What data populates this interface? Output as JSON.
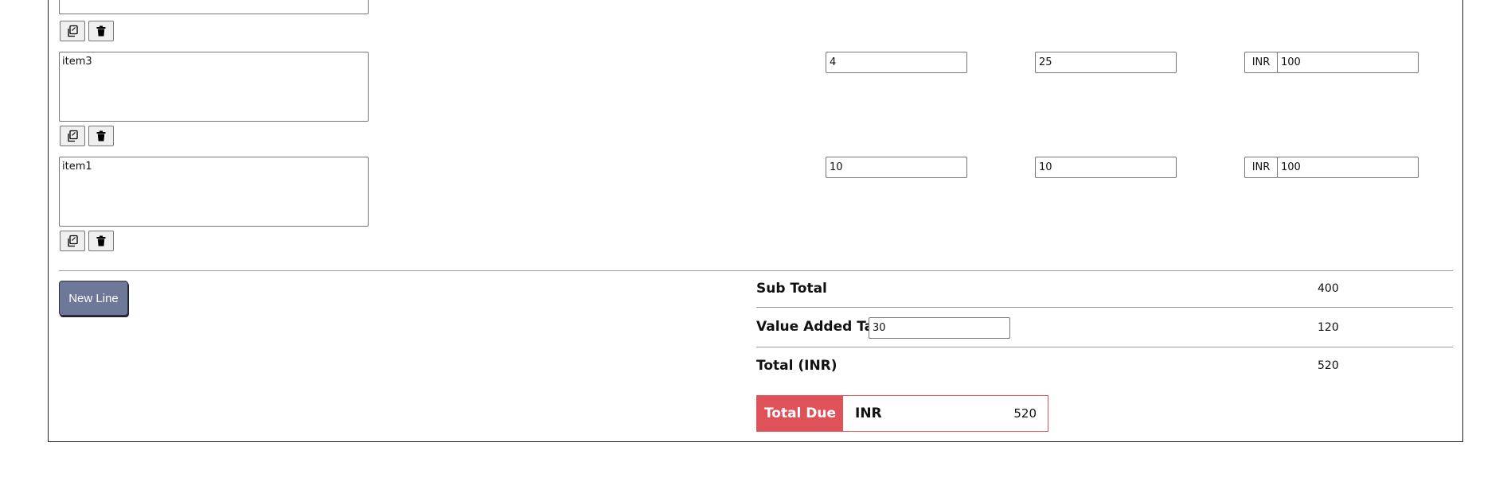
{
  "colors": {
    "new_line_button_bg": "#6e7898",
    "total_due_accent": "#e0525a"
  },
  "line_items": [
    {
      "description": "",
      "quantity": "",
      "rate": "",
      "currency": "",
      "amount": "",
      "copy_icon": "copy-icon",
      "delete_icon": "trash-icon"
    },
    {
      "description": "item3",
      "quantity": "4",
      "rate": "25",
      "currency": "INR",
      "amount": "100",
      "copy_icon": "copy-icon",
      "delete_icon": "trash-icon"
    },
    {
      "description": "item1",
      "quantity": "10",
      "rate": "10",
      "currency": "INR",
      "amount": "100",
      "copy_icon": "copy-icon",
      "delete_icon": "trash-icon"
    }
  ],
  "new_line_button": "New Line",
  "summary": {
    "subtotal_label": "Sub Total",
    "subtotal_value": "400",
    "tax_label": "Value Added Tax",
    "tax_rate": "30",
    "tax_value": "120",
    "total_label": "Total (INR)",
    "total_value": "520"
  },
  "total_due": {
    "label": "Total Due",
    "currency": "INR",
    "amount": "520"
  }
}
